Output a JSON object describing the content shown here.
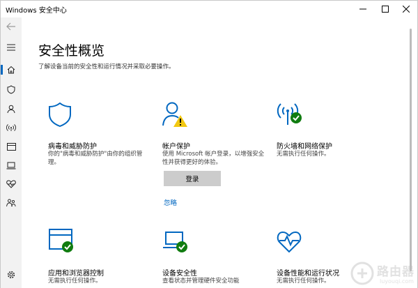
{
  "window": {
    "title": "Windows 安全中心"
  },
  "page": {
    "title": "安全性概览",
    "subtitle": "了解设备当前的安全性和运行情况并采取必要操作。"
  },
  "tiles": [
    {
      "title": "病毒和威胁防护",
      "desc": "你的\"病毒和威胁防护\"由你的组织管理。",
      "icon": "shield-icon"
    },
    {
      "title": "帐户保护",
      "desc": "使用 Microsoft 帐户登录，以增强安全性并获得更好的体验。",
      "icon": "account-warning-icon"
    },
    {
      "title": "防火墙和网络保护",
      "desc": "无需执行任何操作。",
      "icon": "firewall-network-icon"
    },
    {
      "title": "应用和浏览器控制",
      "desc": "无需执行任何操作。",
      "icon": "app-browser-icon"
    },
    {
      "title": "设备安全性",
      "desc": "查看状态并管理硬件安全功能",
      "icon": "laptop-icon"
    },
    {
      "title": "设备性能和运行状况",
      "desc": "无需执行任何操作。",
      "icon": "heart-pulse-icon"
    }
  ],
  "account": {
    "login_label": "登录",
    "ignore_label": "忽略"
  },
  "watermark": {
    "cn": "路由器",
    "en": "luyouqi.com"
  },
  "colors": {
    "accent": "#0067c0",
    "ok": "#107c10",
    "warning": "#f2c811"
  }
}
